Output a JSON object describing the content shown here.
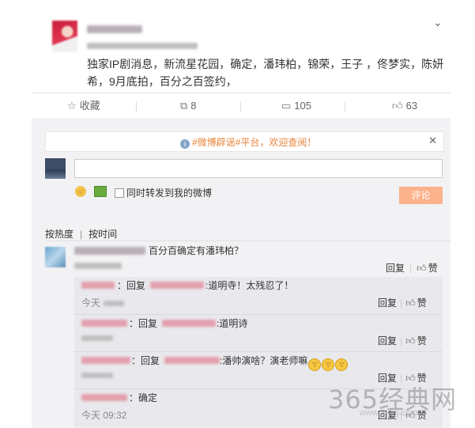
{
  "post": {
    "content": "独家IP剧消息，新流星花园，确定，潘玮柏，锦荣，王子 ，佟梦实，陈妍希，9月底拍，百分之百签约，"
  },
  "actions": {
    "favorite": "收藏",
    "forward_count": "8",
    "comment_count": "105",
    "like_count": "63"
  },
  "notice": {
    "text": "#微博辟谣#平台，欢迎查阅！"
  },
  "composer": {
    "repost_label": "同时转发到我的微博",
    "submit_label": "评论"
  },
  "sort_tabs": {
    "hot": "按热度",
    "time": "按时间"
  },
  "top_comment": {
    "text": "百分百确定有潘玮柏？",
    "reply_label": "回复",
    "like_label": "赞"
  },
  "replies": [
    {
      "prefix": "：回复",
      "text": ":道明寺！太残忍了！",
      "time": "今天",
      "reply_label": "回复",
      "like_label": "赞"
    },
    {
      "prefix": "：回复",
      "text": ":道明诗",
      "time": "",
      "reply_label": "回复",
      "like_label": "赞"
    },
    {
      "prefix": "：回复",
      "text": ":潘帅演啥？演老师嘛",
      "time": "",
      "reply_label": "回复",
      "like_label": "赞"
    },
    {
      "prefix": "：",
      "text": "确定",
      "time": "今天 09:32",
      "reply_label": "回复",
      "like_label": "赞"
    }
  ],
  "watermark": {
    "main": "365经典网",
    "sub": "www.365jj.com"
  },
  "icons": {
    "collect": "star-outline-icon",
    "forward": "forward-icon",
    "comment": "comment-icon",
    "like": "thumb-up-icon"
  },
  "colors": {
    "accent_orange": "#fcb28a",
    "notice_text": "#e8833a"
  }
}
